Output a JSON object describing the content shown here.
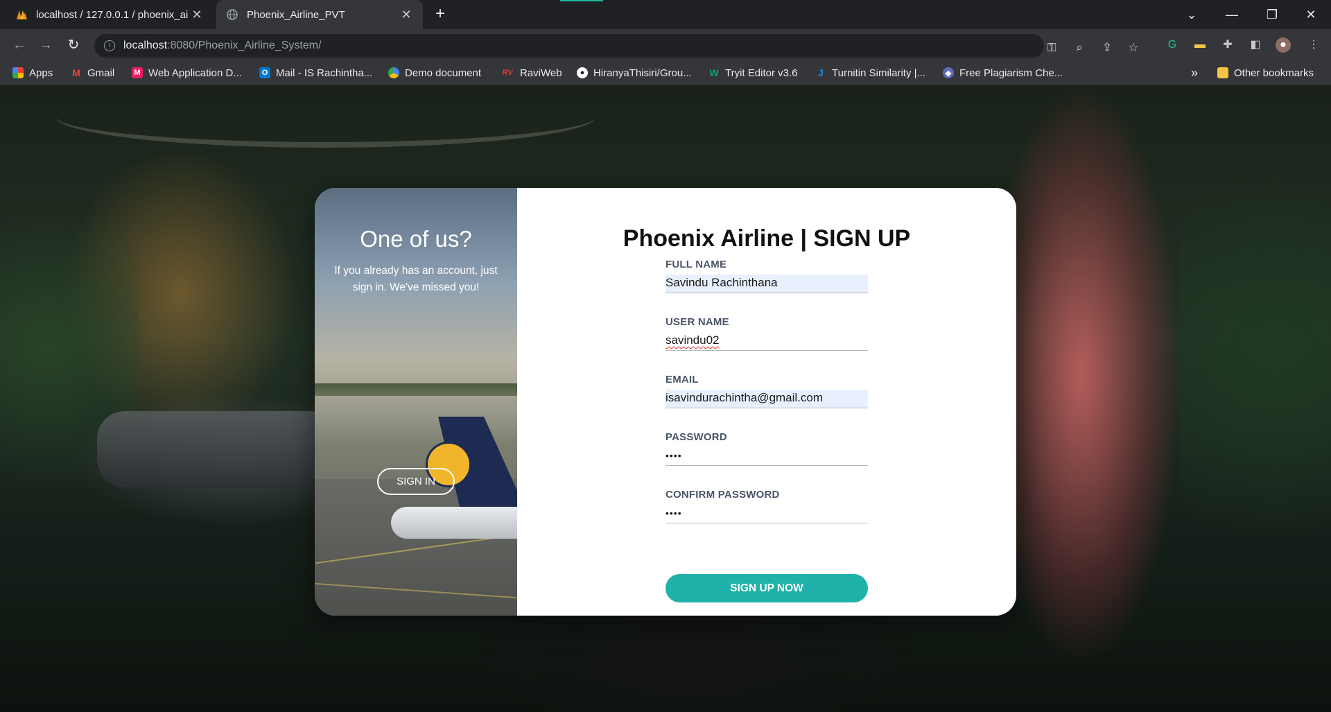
{
  "browser": {
    "tabs": [
      {
        "title": "localhost / 127.0.0.1 / phoenix_ai",
        "active": false
      },
      {
        "title": "Phoenix_Airline_PVT",
        "active": true
      }
    ],
    "url_host": "localhost",
    "url_rest": ":8080/Phoenix_Airline_System/",
    "bookmarks": [
      {
        "label": "Apps",
        "icon": "apps-grid-icon",
        "color": "#4285f4"
      },
      {
        "label": "Gmail",
        "icon": "gmail-icon",
        "color": "#ea4335"
      },
      {
        "label": "Web Application D...",
        "icon": "web-app-icon",
        "color": "#e91e63"
      },
      {
        "label": "Mail - IS Rachintha...",
        "icon": "outlook-icon",
        "color": "#0078d4"
      },
      {
        "label": "Demo document",
        "icon": "google-docs-icon",
        "color": "#fbbc04"
      },
      {
        "label": "RaviWeb",
        "icon": "raviweb-icon",
        "color": "#c62828"
      },
      {
        "label": "HiranyaThisiri/Grou...",
        "icon": "github-icon",
        "color": "#ffffff"
      },
      {
        "label": "Tryit Editor v3.6",
        "icon": "w3schools-icon",
        "color": "#04aa6d"
      },
      {
        "label": "Turnitin Similarity |...",
        "icon": "turnitin-icon",
        "color": "#1e88e5"
      },
      {
        "label": "Free Plagiarism Che...",
        "icon": "plagiarism-icon",
        "color": "#90caf9"
      }
    ],
    "overflow": "»",
    "other_bookmarks": "Other bookmarks"
  },
  "page": {
    "left": {
      "title": "One of us?",
      "text": "If you already has an account, just sign in. We've missed you!",
      "signin_label": "SIGN IN"
    },
    "form": {
      "title": "Phoenix Airline | SIGN UP",
      "full_name_label": "FULL NAME",
      "full_name_value": "Savindu Rachinthana",
      "user_name_label": "USER NAME",
      "user_name_value": "savindu02",
      "email_label": "EMAIL",
      "email_value": "isavindurachintha@gmail.com",
      "password_label": "PASSWORD",
      "password_value": "••••",
      "confirm_label": "CONFIRM PASSWORD",
      "confirm_value": "••••",
      "submit_label": "SIGN UP NOW"
    },
    "colors": {
      "accent": "#20b2aa",
      "autofill": "#e8f0fe"
    }
  }
}
